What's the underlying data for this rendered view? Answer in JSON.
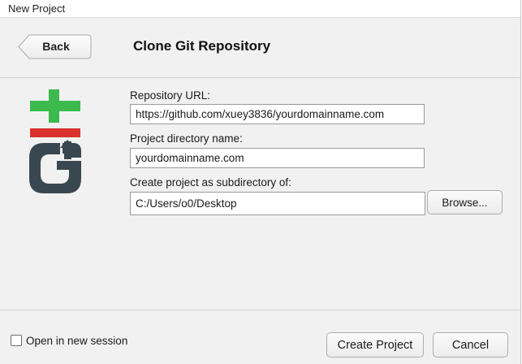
{
  "window": {
    "title": "New Project"
  },
  "header": {
    "back_label": "Back",
    "page_title": "Clone Git Repository"
  },
  "form": {
    "repository_url": {
      "label": "Repository URL:",
      "value": "https://github.com/xuey3836/yourdomainname.com"
    },
    "project_directory": {
      "label": "Project directory name:",
      "value": "yourdomainname.com"
    },
    "subdirectory": {
      "label": "Create project as subdirectory of:",
      "value": "C:/Users/o0/Desktop",
      "browse_label": "Browse..."
    }
  },
  "footer": {
    "new_session_label": "Open in new session",
    "new_session_checked": false,
    "create_label": "Create Project",
    "cancel_label": "Cancel"
  },
  "logo": {
    "icon": "git-logo-icon",
    "colors": {
      "plus": "#3dba4e",
      "minus": "#d9312c",
      "letters": "#394750"
    }
  }
}
